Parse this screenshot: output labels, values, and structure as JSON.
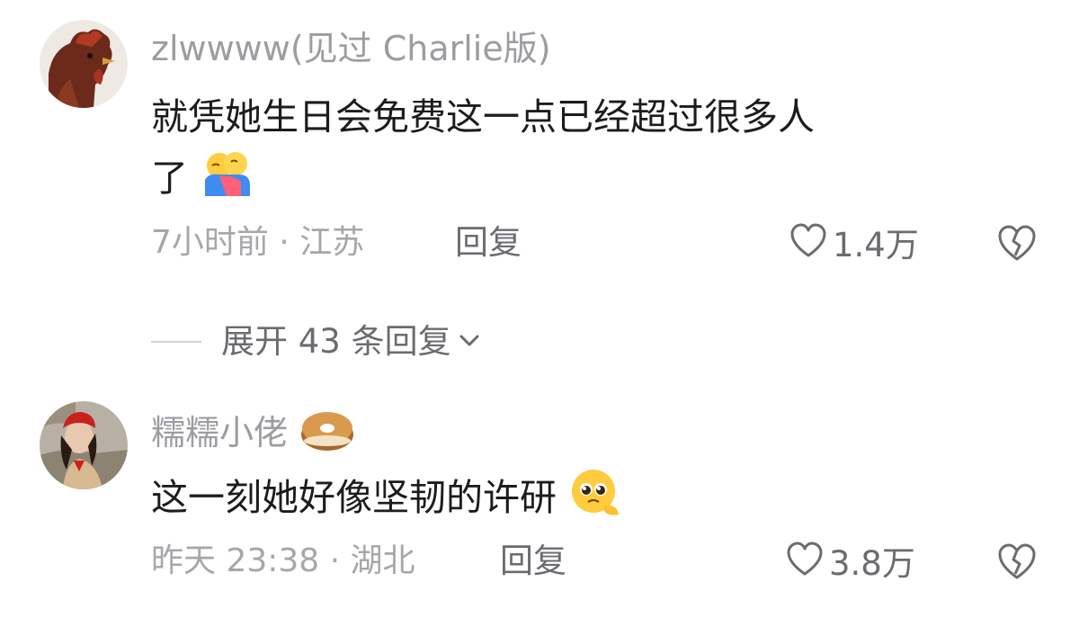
{
  "comments": [
    {
      "username": "zlwwww(见过 Charlie版)",
      "text_line1": "就凭她生日会免费这一点已经超过很多人",
      "text_line2": "了",
      "time_location": "7小时前 · 江苏",
      "reply_label": "回复",
      "likes": "1.4万",
      "inline_emoji": "hug-emoji"
    },
    {
      "username": "糯糯小佬",
      "username_emoji": "bagel-emoji",
      "text": "这一刻她好像坚韧的许研",
      "time_location": "昨天 23:38 · 湖北",
      "reply_label": "回复",
      "likes": "3.8万",
      "inline_emoji": "pleading-emoji"
    }
  ],
  "expand_replies": {
    "label": "展开 43 条回复"
  },
  "colors": {
    "username": "#9c9ca1",
    "text": "#1c1c1e",
    "meta": "#a7a7ab",
    "action": "#6b6b70"
  }
}
